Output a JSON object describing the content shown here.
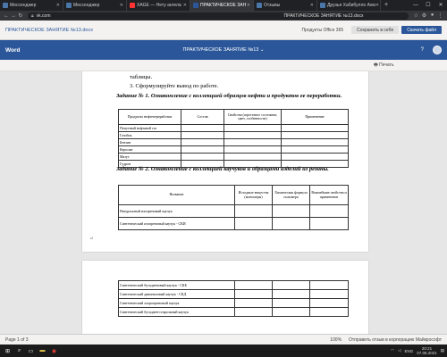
{
  "browser": {
    "tabs": [
      {
        "label": "Мессенджер",
        "active": false,
        "color": "#4a76a8"
      },
      {
        "label": "Мессенджер",
        "active": false,
        "color": "#4a76a8"
      },
      {
        "label": "XAGE — Нету ангела",
        "active": false,
        "color": "#ff3333"
      },
      {
        "label": "ПРАКТИЧЕСКОЕ ЗАН",
        "active": true,
        "color": "#2b579a"
      },
      {
        "label": "Отзывы",
        "active": false,
        "color": "#4a76a8"
      },
      {
        "label": "Друзья Хабибулло Ахм",
        "active": false,
        "color": "#4a76a8"
      }
    ],
    "new_tab": "+",
    "window_controls": [
      "—",
      "☐",
      "✕"
    ],
    "url": "vk.com",
    "page_title": "ПРАКТИЧЕСКОЕ ЗАНЯТИЕ №13.docx"
  },
  "office": {
    "doc_link": "ПРАКТИЧЕСКОЕ ЗАНЯТИЕ №13.docx",
    "buttons": {
      "products": "Продукты Office 365",
      "save": "Сохранить в себе",
      "download": "Скачать файл"
    },
    "app_name": "Word",
    "doc_title": "ПРАКТИЧЕСКОЕ ЗАНЯТИЕ №13 ⌄",
    "print": "Печать"
  },
  "document": {
    "line1": "таблицы.",
    "line2": "3.  Сформулируйте вывод по работе.",
    "task1": "Задание № 1. Ознакомление с коллекцией образцов нефти и продуктов ее переработки.",
    "table1": {
      "headers": [
        "Продукты нефтепереработки",
        "Состав",
        "Свойства (агрегатное состояние, цвет, особенности)",
        "Применение"
      ],
      "rows": [
        "Попутный нефтяной газ",
        "Газойль",
        "Бензин",
        "Керосин",
        "Мазут",
        "Гудрон"
      ]
    },
    "task2": "Задание № 2. Ознакомление с коллекцией каучуков и образцами изделий из резины.",
    "table2": {
      "headers": [
        "Название",
        "Исходные вещества (мономеры)",
        "Химическая формула полимера",
        "Важнейшие свойства и применение"
      ],
      "rows": [
        "Натуральный изопреновый каучук",
        "Синтетический изопреновый каучук - СКИ"
      ]
    },
    "table3": {
      "rows": [
        "Синтетический бутадиеновый каучук - СКБ",
        "Синтетический дивиниловый каучук - СКД",
        "Синтетический хлоропреновый каучук",
        "Синтетический бутадиен-стирольный каучук"
      ]
    }
  },
  "status": {
    "page": "Page 1 of 3",
    "zoom": "100%",
    "feedback": "Отправить отзыв в корпорацию Майкрософт"
  },
  "taskbar": {
    "tray_lang": "ENG",
    "time": "20:21",
    "date": "07.06.2021"
  }
}
